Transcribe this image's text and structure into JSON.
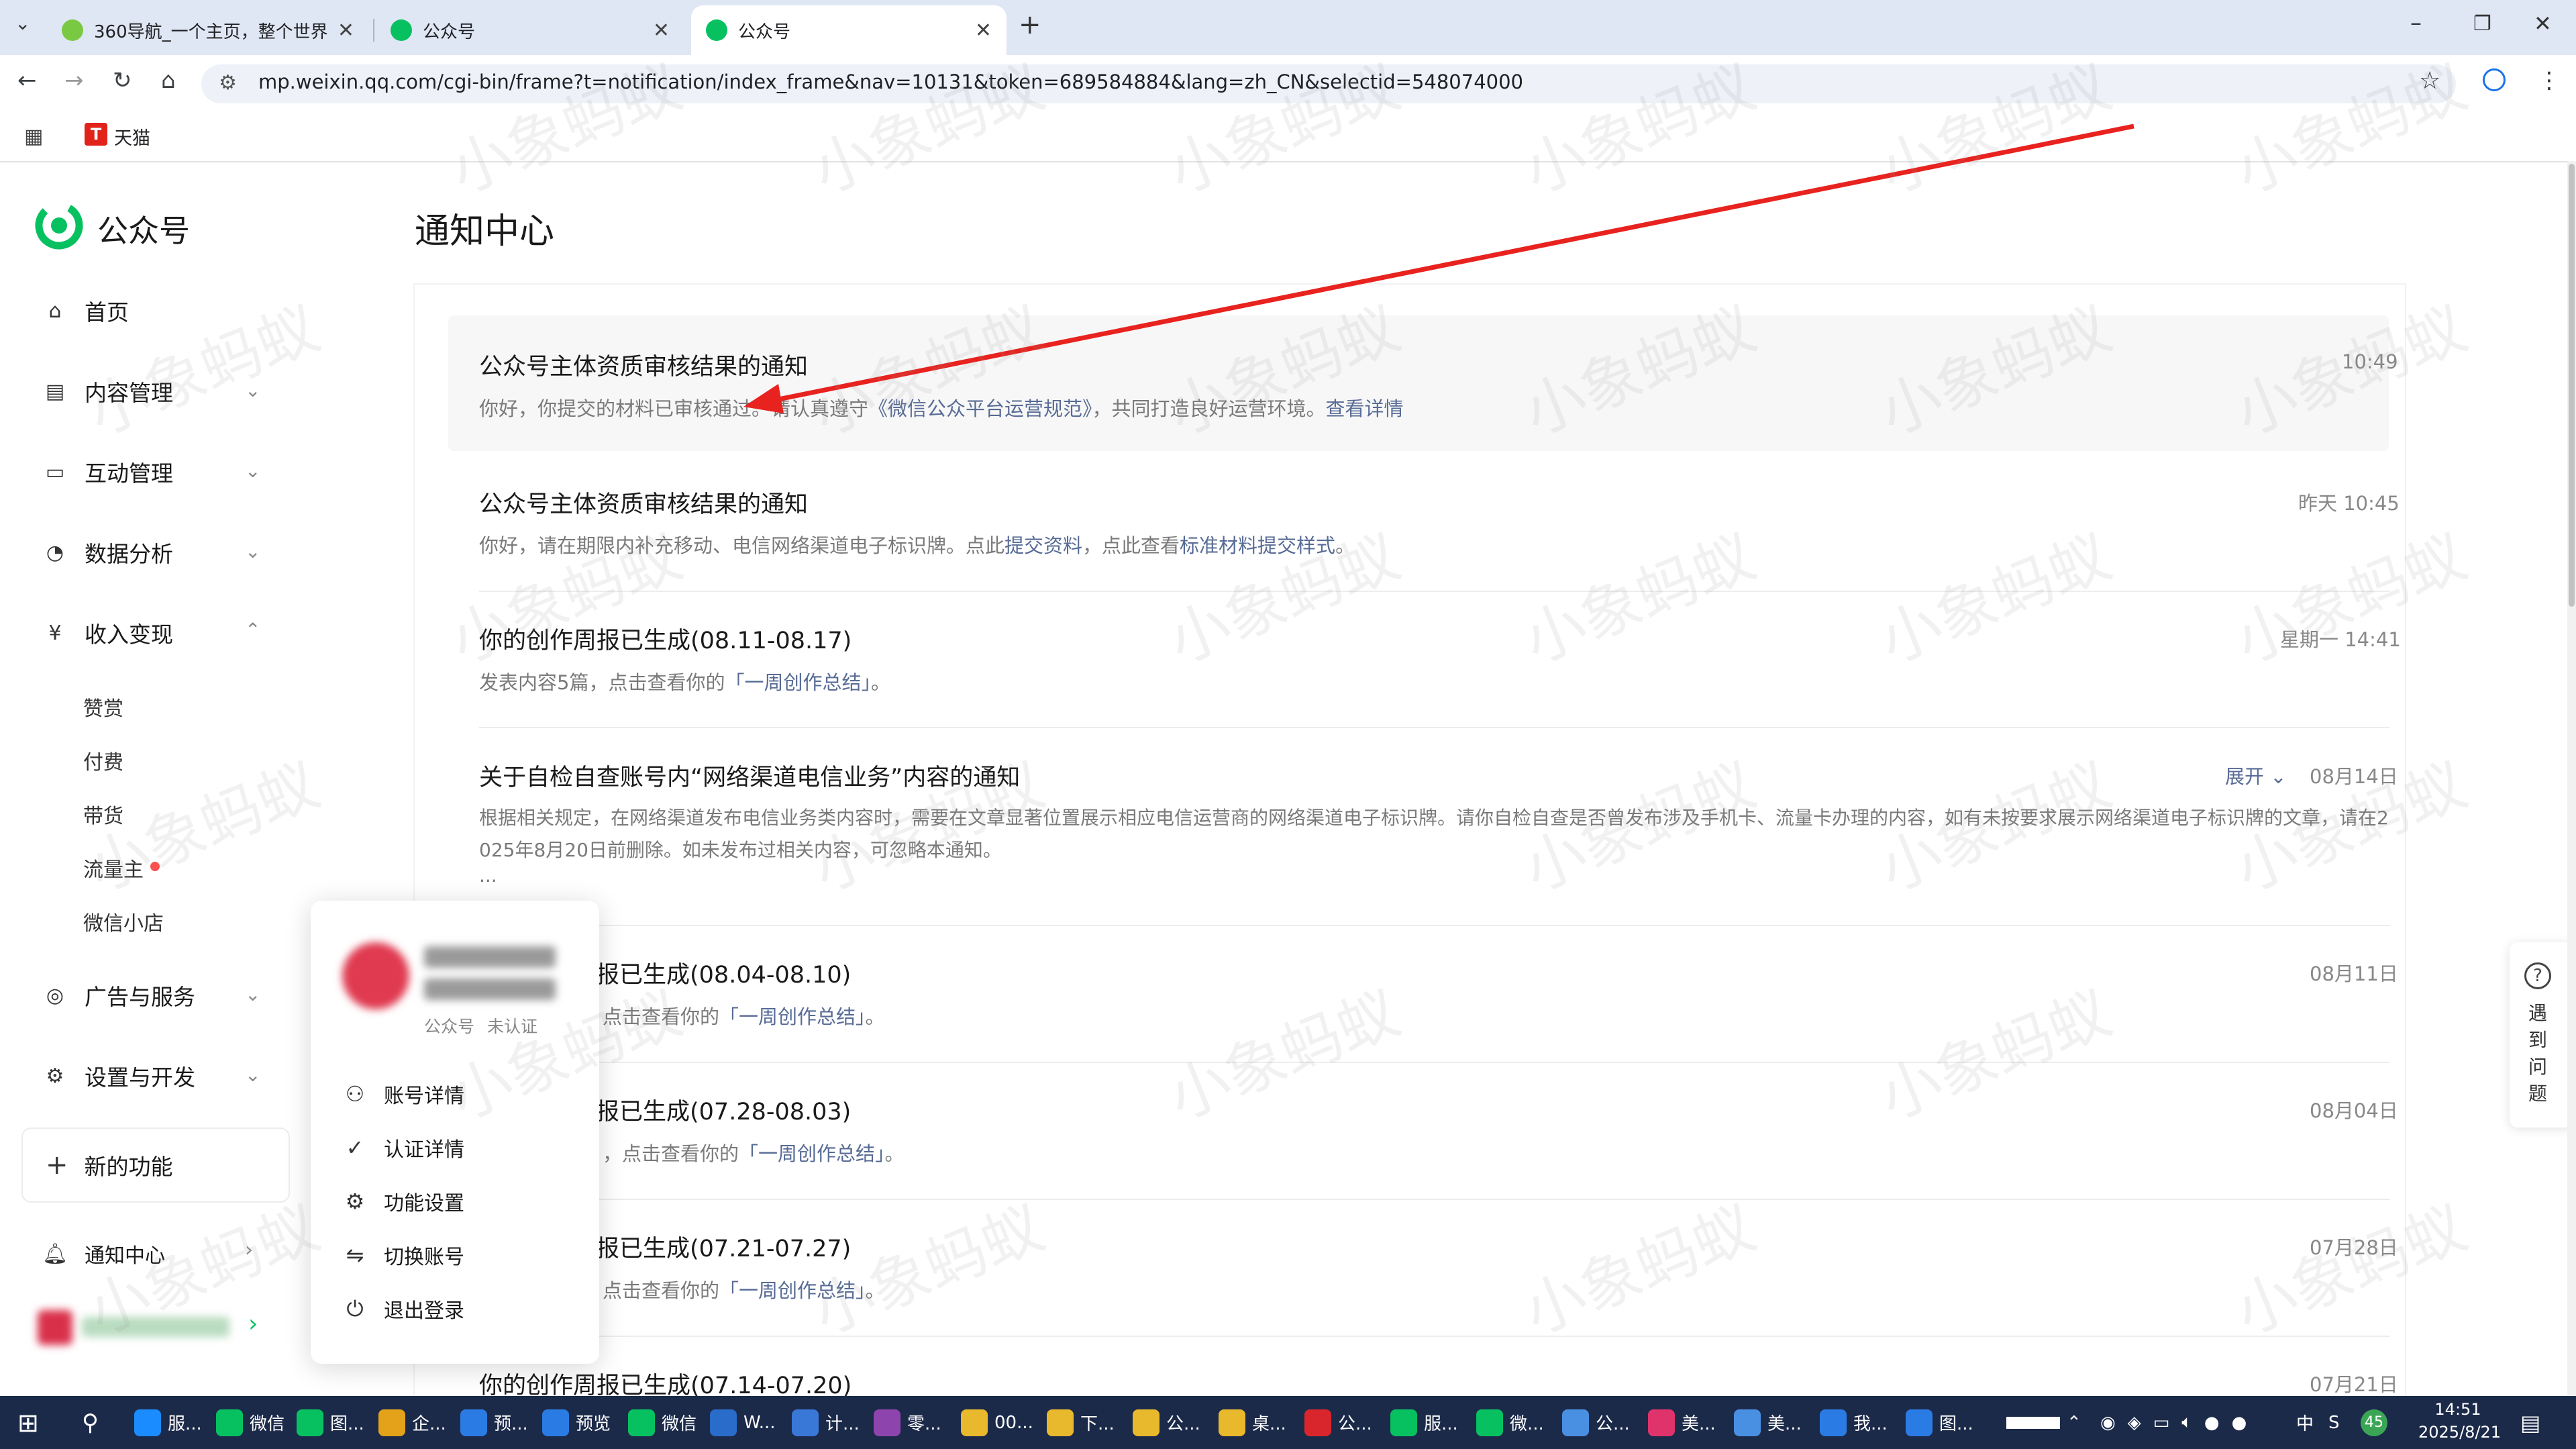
{
  "browser": {
    "tabs": [
      {
        "title": "360导航_一个主页，整个世界",
        "active": false
      },
      {
        "title": "公众号",
        "active": false
      },
      {
        "title": "公众号",
        "active": true
      }
    ],
    "url": "mp.weixin.qq.com/cgi-bin/frame?t=notification/index_frame&nav=10131&token=689584884&lang=zh_CN&selectid=548074000",
    "bookmarks": [
      {
        "label": "天猫"
      }
    ]
  },
  "sidebar": {
    "brand": "公众号",
    "items": [
      {
        "label": "首页",
        "icon": "home-icon"
      },
      {
        "label": "内容管理",
        "icon": "document-icon"
      },
      {
        "label": "互动管理",
        "icon": "chat-icon"
      },
      {
        "label": "数据分析",
        "icon": "chart-pie-icon"
      },
      {
        "label": "收入变现",
        "icon": "yen-icon"
      },
      {
        "label": "广告与服务",
        "icon": "compass-icon"
      },
      {
        "label": "设置与开发",
        "icon": "gear-icon"
      }
    ],
    "income_sub": [
      "赞赏",
      "付费",
      "带货",
      "流量主",
      "微信小店"
    ],
    "new_features": "新的功能",
    "notifications": "通知中心"
  },
  "page": {
    "title": "通知中心"
  },
  "notifications": [
    {
      "title": "公众号主体资质审核结果的通知",
      "time": "10:49",
      "desc_before": "你好，你提交的材料已审核通过。请认真遵守",
      "desc_link": "《微信公众平台运营规范》",
      "desc_after": "，共同打造良好运营环境。",
      "desc_link2": "查看详情"
    },
    {
      "title": "公众号主体资质审核结果的通知",
      "time": "昨天 10:45",
      "desc_before": "你好，请在期限内补充移动、电信网络渠道电子标识牌。点此",
      "desc_link": "提交资料",
      "desc_after": "，点此查看",
      "desc_link2": "标准材料提交样式",
      "desc_end": "。"
    },
    {
      "title": "你的创作周报已生成(08.11-08.17)",
      "time": "星期一 14:41",
      "desc_before": "发表内容5篇，点击查看你的",
      "desc_link": "「一周创作总结」",
      "desc_after": "。"
    },
    {
      "title": "关于自检自查账号内“网络渠道电信业务”内容的通知",
      "time": "08月14日",
      "expand": "展开",
      "desc_line1": "根据相关规定，在网络渠道发布电信业务类内容时，需要在文章显著位置展示相应电信运营商的网络渠道电子标识牌。请你自检自查是否曾发布涉及手机卡、流量卡办理的内容，如有未按要求展示网络渠道电子标识牌的文章，请在2",
      "desc_line2": "025年8月20日前删除。如未发布过相关内容，可忽略本通知。",
      "desc_line3": "..."
    },
    {
      "title": "报已生成(08.04-08.10)",
      "time": "08月11日",
      "desc_before": "点击查看你的",
      "desc_link": "「一周创作总结」",
      "desc_after": "。"
    },
    {
      "title": "报已生成(07.28-08.03)",
      "time": "08月04日",
      "desc_before": "，点击查看你的",
      "desc_link": "「一周创作总结」",
      "desc_after": "。"
    },
    {
      "title": "报已生成(07.21-07.27)",
      "time": "07月28日",
      "desc_before": "点击查看你的",
      "desc_link": "「一周创作总结」",
      "desc_after": "。"
    },
    {
      "title": "你的创作周报已生成(07.14-07.20)",
      "time": "07月21日"
    }
  ],
  "account_popup": {
    "type": "公众号",
    "status": "未认证",
    "menu": [
      {
        "label": "账号详情",
        "icon": "user-icon"
      },
      {
        "label": "认证详情",
        "icon": "check-circle-icon"
      },
      {
        "label": "功能设置",
        "icon": "gear-icon"
      },
      {
        "label": "切换账号",
        "icon": "switch-icon"
      },
      {
        "label": "退出登录",
        "icon": "power-icon"
      }
    ]
  },
  "help": {
    "label": "遇到问题"
  },
  "taskbar": {
    "apps": [
      "服...",
      "微信",
      "图...",
      "企...",
      "预...",
      "预览",
      "微信",
      "W...",
      "计...",
      "零...",
      "00...",
      "下...",
      "公...",
      "桌...",
      "公...",
      "服...",
      "微...",
      "公...",
      "美...",
      "美...",
      "我...",
      "图..."
    ],
    "time": "14:51",
    "date": "2025/8/21",
    "ime": "中",
    "badge": "45"
  },
  "watermark": "小象蚂蚁",
  "colors": {
    "link": "#576b95",
    "brand_green": "#07c160",
    "taskbar": "#1c2a4a",
    "red_dot": "#fa5151",
    "annotation_arrow": "#e8231f"
  }
}
